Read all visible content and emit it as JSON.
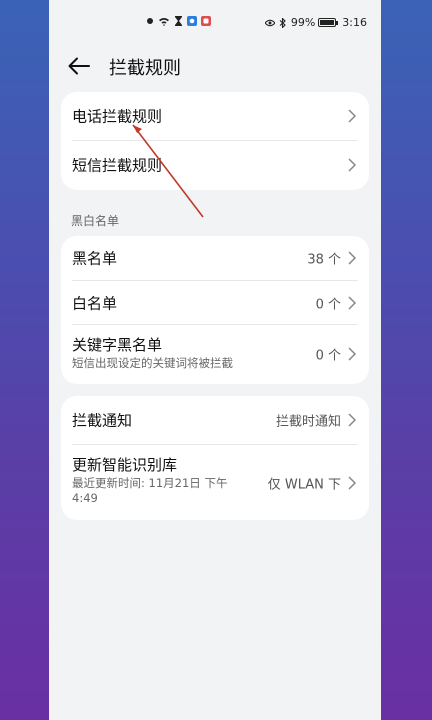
{
  "status_bar": {
    "battery": "99%",
    "time": "3:16"
  },
  "header": {
    "title": "拦截规则"
  },
  "rules": {
    "items": [
      {
        "label": "电话拦截规则"
      },
      {
        "label": "短信拦截规则"
      }
    ]
  },
  "blackwhite": {
    "section_title": "黑白名单",
    "blacklist": {
      "label": "黑名单",
      "value": "38 个"
    },
    "whitelist": {
      "label": "白名单",
      "value": "0 个"
    },
    "keyword": {
      "label": "关键字黑名单",
      "sub": "短信出现设定的关键词将被拦截",
      "value": "0 个"
    }
  },
  "notify": {
    "label": "拦截通知",
    "value": "拦截时通知"
  },
  "update": {
    "label": "更新智能识别库",
    "sub_line1": "最近更新时间: 11月21日 下午",
    "sub_line2": "4:49",
    "value": "仅 WLAN 下"
  },
  "colors": {
    "annotation_arrow": "#c0392b",
    "card_bg": "#ffffff",
    "page_bg": "#f1f3f5"
  }
}
